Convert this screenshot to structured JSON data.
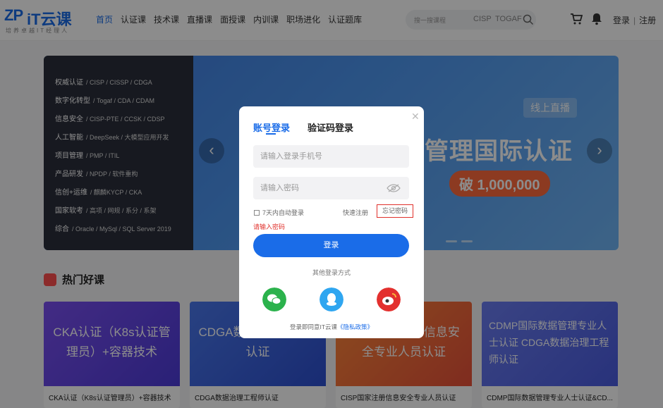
{
  "header": {
    "logo_mark": "ZP",
    "logo_text": "iT云课",
    "logo_sub": "培养卓越IT经理人",
    "nav": [
      "首页",
      "认证课",
      "技术课",
      "直播课",
      "面授课",
      "内训课",
      "职场进化",
      "认证题库"
    ],
    "search_placeholder": "搜一搜课程",
    "search_tags": [
      "CISP",
      "TOGAF"
    ],
    "login": "登录",
    "register": "注册"
  },
  "banner": {
    "categories": [
      {
        "title": "权威认证",
        "items": "/ CISP / CISSP / CDGA"
      },
      {
        "title": "数字化转型",
        "items": "/ Togaf / CDA / CDAM"
      },
      {
        "title": "信息安全",
        "items": "/ CISP-PTE / CCSK / CDSP"
      },
      {
        "title": "人工智能",
        "items": "/ DeepSeek / 大模型应用开发"
      },
      {
        "title": "项目管理",
        "items": "/ PMP / ITIL"
      },
      {
        "title": "产品研发",
        "items": "/ NPDP / 软件重构"
      },
      {
        "title": "信创+运维",
        "items": "/ 麒麟KYCP / CKA"
      },
      {
        "title": "国家软考",
        "items": "/ 高项 / 网规 / 系分 / 系架"
      },
      {
        "title": "综合",
        "items": "/ Oracle / MySql / SQL Server 2019"
      }
    ],
    "badge": "线上直播",
    "title": "管理国际认证",
    "pill": "破 1,000,000"
  },
  "hot": {
    "title": "热门好课",
    "cards": [
      {
        "img_text": "CKA认证（K8s认证管理员）+容器技术",
        "caption": "CKA认证（K8s认证管理员）+容器技术",
        "color": "#6b4fe6"
      },
      {
        "img_text": "CDGA数据治理工程师认证",
        "caption": "CDGA数据治理工程师认证",
        "color": "#3a62e0"
      },
      {
        "img_text": "CISP国家注册信息安全专业人员认证",
        "caption": "CISP国家注册信息安全专业人员认证",
        "color": "#f07a3a"
      },
      {
        "img_text": "CDMP国际数据管理专业人士认证 CDGA数据治理工程师认证",
        "caption": "CDMP国际数据管理专业人士认证&CD...",
        "color": "#5a6ee8"
      }
    ]
  },
  "modal": {
    "tab_account": "账号登录",
    "tab_code": "验证码登录",
    "phone_placeholder": "请输入登录手机号",
    "password_placeholder": "请输入密码",
    "remember": "7天内自动登录",
    "quick_register": "快速注册",
    "forgot": "忘记密码",
    "error": "请输入密码",
    "login_button": "登录",
    "other_methods": "其他登录方式",
    "policy_prefix": "登录即同意IT云课",
    "policy_link": "《隐私政策》"
  }
}
